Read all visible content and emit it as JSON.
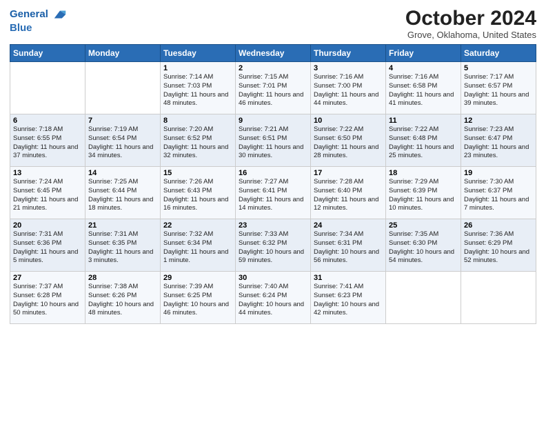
{
  "header": {
    "logo_line1": "General",
    "logo_line2": "Blue",
    "main_title": "October 2024",
    "subtitle": "Grove, Oklahoma, United States"
  },
  "weekdays": [
    "Sunday",
    "Monday",
    "Tuesday",
    "Wednesday",
    "Thursday",
    "Friday",
    "Saturday"
  ],
  "weeks": [
    [
      {
        "day": "",
        "text": ""
      },
      {
        "day": "",
        "text": ""
      },
      {
        "day": "1",
        "text": "Sunrise: 7:14 AM\nSunset: 7:03 PM\nDaylight: 11 hours and 48 minutes."
      },
      {
        "day": "2",
        "text": "Sunrise: 7:15 AM\nSunset: 7:01 PM\nDaylight: 11 hours and 46 minutes."
      },
      {
        "day": "3",
        "text": "Sunrise: 7:16 AM\nSunset: 7:00 PM\nDaylight: 11 hours and 44 minutes."
      },
      {
        "day": "4",
        "text": "Sunrise: 7:16 AM\nSunset: 6:58 PM\nDaylight: 11 hours and 41 minutes."
      },
      {
        "day": "5",
        "text": "Sunrise: 7:17 AM\nSunset: 6:57 PM\nDaylight: 11 hours and 39 minutes."
      }
    ],
    [
      {
        "day": "6",
        "text": "Sunrise: 7:18 AM\nSunset: 6:55 PM\nDaylight: 11 hours and 37 minutes."
      },
      {
        "day": "7",
        "text": "Sunrise: 7:19 AM\nSunset: 6:54 PM\nDaylight: 11 hours and 34 minutes."
      },
      {
        "day": "8",
        "text": "Sunrise: 7:20 AM\nSunset: 6:52 PM\nDaylight: 11 hours and 32 minutes."
      },
      {
        "day": "9",
        "text": "Sunrise: 7:21 AM\nSunset: 6:51 PM\nDaylight: 11 hours and 30 minutes."
      },
      {
        "day": "10",
        "text": "Sunrise: 7:22 AM\nSunset: 6:50 PM\nDaylight: 11 hours and 28 minutes."
      },
      {
        "day": "11",
        "text": "Sunrise: 7:22 AM\nSunset: 6:48 PM\nDaylight: 11 hours and 25 minutes."
      },
      {
        "day": "12",
        "text": "Sunrise: 7:23 AM\nSunset: 6:47 PM\nDaylight: 11 hours and 23 minutes."
      }
    ],
    [
      {
        "day": "13",
        "text": "Sunrise: 7:24 AM\nSunset: 6:45 PM\nDaylight: 11 hours and 21 minutes."
      },
      {
        "day": "14",
        "text": "Sunrise: 7:25 AM\nSunset: 6:44 PM\nDaylight: 11 hours and 18 minutes."
      },
      {
        "day": "15",
        "text": "Sunrise: 7:26 AM\nSunset: 6:43 PM\nDaylight: 11 hours and 16 minutes."
      },
      {
        "day": "16",
        "text": "Sunrise: 7:27 AM\nSunset: 6:41 PM\nDaylight: 11 hours and 14 minutes."
      },
      {
        "day": "17",
        "text": "Sunrise: 7:28 AM\nSunset: 6:40 PM\nDaylight: 11 hours and 12 minutes."
      },
      {
        "day": "18",
        "text": "Sunrise: 7:29 AM\nSunset: 6:39 PM\nDaylight: 11 hours and 10 minutes."
      },
      {
        "day": "19",
        "text": "Sunrise: 7:30 AM\nSunset: 6:37 PM\nDaylight: 11 hours and 7 minutes."
      }
    ],
    [
      {
        "day": "20",
        "text": "Sunrise: 7:31 AM\nSunset: 6:36 PM\nDaylight: 11 hours and 5 minutes."
      },
      {
        "day": "21",
        "text": "Sunrise: 7:31 AM\nSunset: 6:35 PM\nDaylight: 11 hours and 3 minutes."
      },
      {
        "day": "22",
        "text": "Sunrise: 7:32 AM\nSunset: 6:34 PM\nDaylight: 11 hours and 1 minute."
      },
      {
        "day": "23",
        "text": "Sunrise: 7:33 AM\nSunset: 6:32 PM\nDaylight: 10 hours and 59 minutes."
      },
      {
        "day": "24",
        "text": "Sunrise: 7:34 AM\nSunset: 6:31 PM\nDaylight: 10 hours and 56 minutes."
      },
      {
        "day": "25",
        "text": "Sunrise: 7:35 AM\nSunset: 6:30 PM\nDaylight: 10 hours and 54 minutes."
      },
      {
        "day": "26",
        "text": "Sunrise: 7:36 AM\nSunset: 6:29 PM\nDaylight: 10 hours and 52 minutes."
      }
    ],
    [
      {
        "day": "27",
        "text": "Sunrise: 7:37 AM\nSunset: 6:28 PM\nDaylight: 10 hours and 50 minutes."
      },
      {
        "day": "28",
        "text": "Sunrise: 7:38 AM\nSunset: 6:26 PM\nDaylight: 10 hours and 48 minutes."
      },
      {
        "day": "29",
        "text": "Sunrise: 7:39 AM\nSunset: 6:25 PM\nDaylight: 10 hours and 46 minutes."
      },
      {
        "day": "30",
        "text": "Sunrise: 7:40 AM\nSunset: 6:24 PM\nDaylight: 10 hours and 44 minutes."
      },
      {
        "day": "31",
        "text": "Sunrise: 7:41 AM\nSunset: 6:23 PM\nDaylight: 10 hours and 42 minutes."
      },
      {
        "day": "",
        "text": ""
      },
      {
        "day": "",
        "text": ""
      }
    ]
  ]
}
